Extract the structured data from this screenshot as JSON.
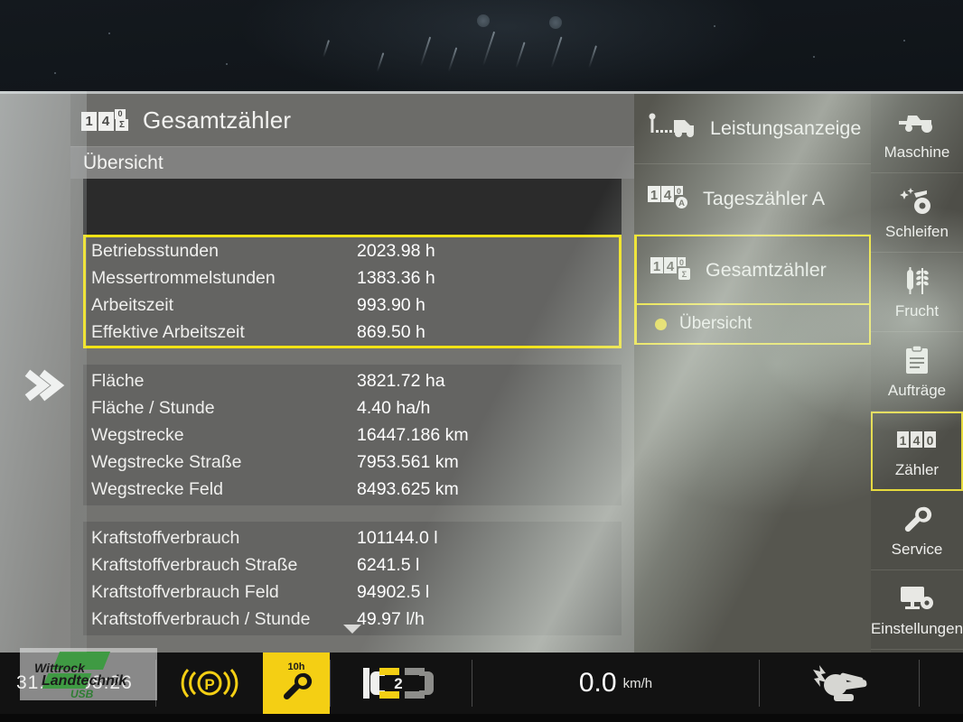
{
  "header": {
    "icon": "counter-14-sigma-icon",
    "title": "Gesamtzähler",
    "subtitle": "Übersicht"
  },
  "table": {
    "groups": [
      {
        "highlighted": true,
        "rows": [
          {
            "label": "Betriebsstunden",
            "value": "2023.98 h"
          },
          {
            "label": "Messertrommelstunden",
            "value": "1383.36 h"
          },
          {
            "label": "Arbeitszeit",
            "value": "993.90 h"
          },
          {
            "label": "Effektive Arbeitszeit",
            "value": "869.50 h"
          }
        ]
      },
      {
        "highlighted": false,
        "rows": [
          {
            "label": "Fläche",
            "value": "3821.72 ha"
          },
          {
            "label": "Fläche / Stunde",
            "value": "4.40 ha/h"
          },
          {
            "label": "Wegstrecke",
            "value": "16447.186 km"
          },
          {
            "label": "Wegstrecke Straße",
            "value": "7953.561 km"
          },
          {
            "label": "Wegstrecke Feld",
            "value": "8493.625 km"
          }
        ]
      },
      {
        "highlighted": false,
        "rows": [
          {
            "label": "Kraftstoffverbrauch",
            "value": "101144.0 l"
          },
          {
            "label": "Kraftstoffverbrauch Straße",
            "value": "6241.5 l"
          },
          {
            "label": "Kraftstoffverbrauch Feld",
            "value": "94902.5 l"
          },
          {
            "label": "Kraftstoffverbrauch / Stunde",
            "value": "49.97 l/h"
          }
        ]
      }
    ],
    "scroll_hint": "scroll-down-arrow"
  },
  "menu": {
    "items": [
      {
        "icon": "performance-truck-icon",
        "label": "Leistungsanzeige",
        "selected": false
      },
      {
        "icon": "counter-14-a-icon",
        "label": "Tageszähler A",
        "selected": false
      },
      {
        "icon": "counter-14-sigma-icon",
        "label": "Gesamtzähler",
        "selected": true
      }
    ],
    "subitem": {
      "label": "Übersicht",
      "selected": true
    }
  },
  "rail": {
    "items": [
      {
        "icon": "tractor-icon",
        "label": "Maschine",
        "selected": false
      },
      {
        "icon": "sharpen-icon",
        "label": "Schleifen",
        "selected": false
      },
      {
        "icon": "crop-icon",
        "label": "Frucht",
        "selected": false
      },
      {
        "icon": "clipboard-icon",
        "label": "Aufträge",
        "selected": false
      },
      {
        "icon": "counter-icon",
        "label": "Zähler",
        "selected": true
      },
      {
        "icon": "wrench-icon",
        "label": "Service",
        "selected": false
      },
      {
        "icon": "monitor-gear-icon",
        "label": "Einstellungen",
        "selected": false
      }
    ]
  },
  "statusbar": {
    "clock": "31.08.  08:26",
    "parking_brake": "parking-brake-icon",
    "service_badge": "10h",
    "service_icon": "wrench-icon",
    "gear_indicator": "2",
    "gear_icon": "drivetrain-icon",
    "speed": "0.0",
    "speed_unit": "km/h",
    "right_icon": "chopper-unit-icon"
  },
  "left_rail": {
    "icon": "double-chevron-right-icon"
  },
  "watermark": {
    "line1": "Wittrock",
    "line2": "Landtechnik",
    "usb": "USB"
  },
  "colors": {
    "accent_yellow": "#f2e315",
    "panel_gray": "#737370",
    "status_bg": "#121212"
  }
}
